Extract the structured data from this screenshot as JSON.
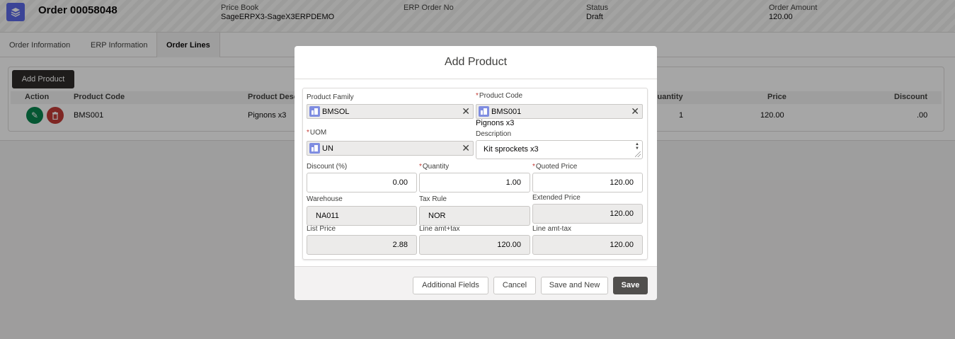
{
  "record": {
    "title": "Order 00058048",
    "icon": "stacked-layers-icon",
    "fields": [
      {
        "label": "Price Book",
        "value": "SageERPX3-SageX3ERPDEMO"
      },
      {
        "label": "ERP Order No",
        "value": ""
      },
      {
        "label": "Status",
        "value": "Draft"
      },
      {
        "label": "Order Amount",
        "value": "120.00"
      }
    ]
  },
  "tabs": [
    "Order Information",
    "ERP Information",
    "Order Lines"
  ],
  "active_tab": "Order Lines",
  "lines": {
    "add_button": "Add Product",
    "headers": {
      "action": "Action",
      "product_code": "Product Code",
      "description": "Product Desc",
      "quantity": "Quantity",
      "price": "Price",
      "discount": "Discount"
    },
    "rows": [
      {
        "product_code": "BMS001",
        "description": "Pignons x3",
        "quantity": "1",
        "price": "120.00",
        "discount": ".00"
      }
    ]
  },
  "modal": {
    "title": "Add Product",
    "product_family": {
      "label": "Product Family",
      "value": "BMSOL"
    },
    "product_code": {
      "label": "Product Code",
      "value": "BMS001",
      "subtext": "Pignons x3"
    },
    "uom": {
      "label": "UOM",
      "value": "UN"
    },
    "description": {
      "label": "Description",
      "value": "Kit sprockets x3"
    },
    "discount": {
      "label": "Discount (%)",
      "value": "0.00"
    },
    "quantity": {
      "label": "Quantity",
      "value": "1.00"
    },
    "quoted_price": {
      "label": "Quoted Price",
      "value": "120.00"
    },
    "warehouse": {
      "label": "Warehouse",
      "value": "NA011"
    },
    "tax_rule": {
      "label": "Tax Rule",
      "value": "NOR"
    },
    "extended_price": {
      "label": "Extended Price",
      "value": "120.00"
    },
    "list_price": {
      "label": "List Price",
      "value": "2.88"
    },
    "line_amt_plus_tax": {
      "label": "Line amt+tax",
      "value": "120.00"
    },
    "line_amt_minus_tax": {
      "label": "Line amt-tax",
      "value": "120.00"
    },
    "buttons": {
      "additional": "Additional Fields",
      "cancel": "Cancel",
      "save_new": "Save and New",
      "save": "Save"
    }
  },
  "colors": {
    "brand_icon": "#5867e8",
    "required": "#c23934",
    "edit": "#04844b",
    "delete": "#c23934",
    "primary_button": "#514f4d"
  }
}
